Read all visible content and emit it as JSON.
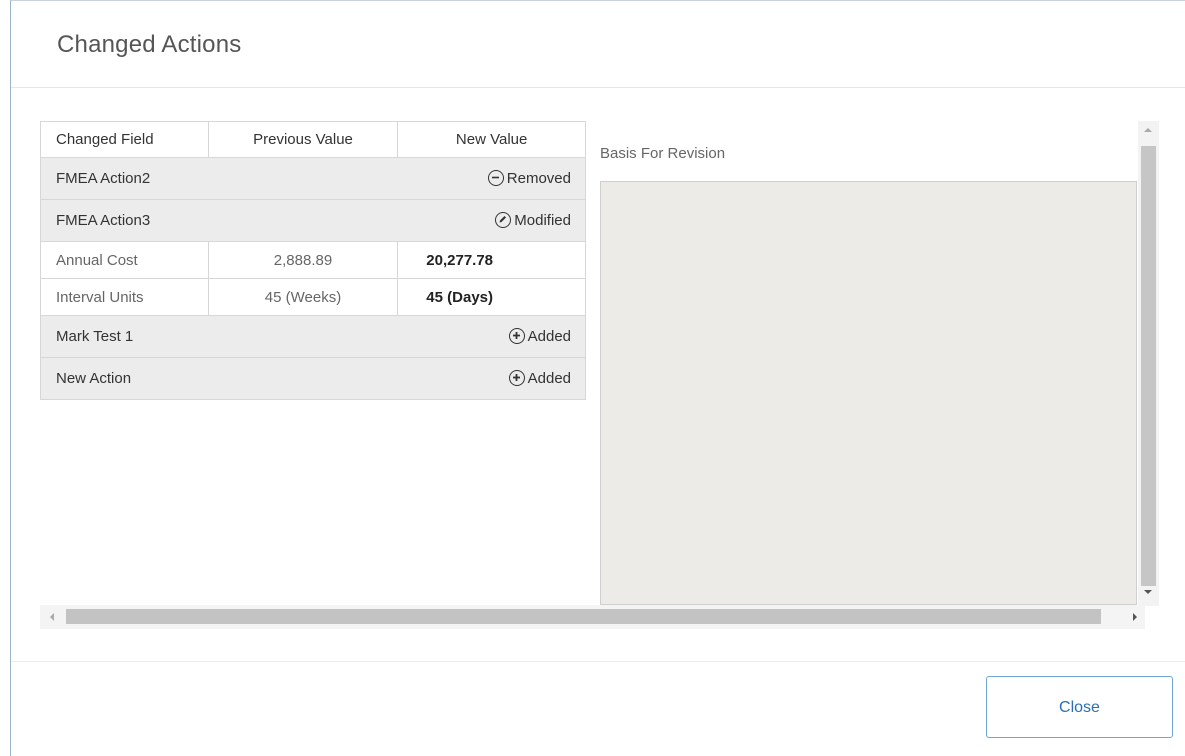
{
  "dialog": {
    "title": "Changed Actions",
    "close_label": "Close"
  },
  "table": {
    "headers": [
      "Changed Field",
      "Previous Value",
      "New Value"
    ],
    "rows": [
      {
        "type": "group",
        "name": "FMEA Action2",
        "status": "Removed",
        "icon": "minus-circle-icon"
      },
      {
        "type": "group",
        "name": "FMEA Action3",
        "status": "Modified",
        "icon": "pencil-circle-icon"
      },
      {
        "type": "detail",
        "field": "Annual Cost",
        "previous": "2,888.89",
        "new": "20,277.78"
      },
      {
        "type": "detail",
        "field": "Interval Units",
        "previous": "45 (Weeks)",
        "new": "45 (Days)"
      },
      {
        "type": "group",
        "name": "Mark Test 1",
        "status": "Added",
        "icon": "plus-circle-icon"
      },
      {
        "type": "group",
        "name": "New Action",
        "status": "Added",
        "icon": "plus-circle-icon"
      }
    ]
  },
  "basis": {
    "label": "Basis For Revision",
    "value": ""
  },
  "colors": {
    "accent": "#2a6fb0",
    "group_row_bg": "#ececec",
    "textarea_bg": "#ecebe8"
  }
}
